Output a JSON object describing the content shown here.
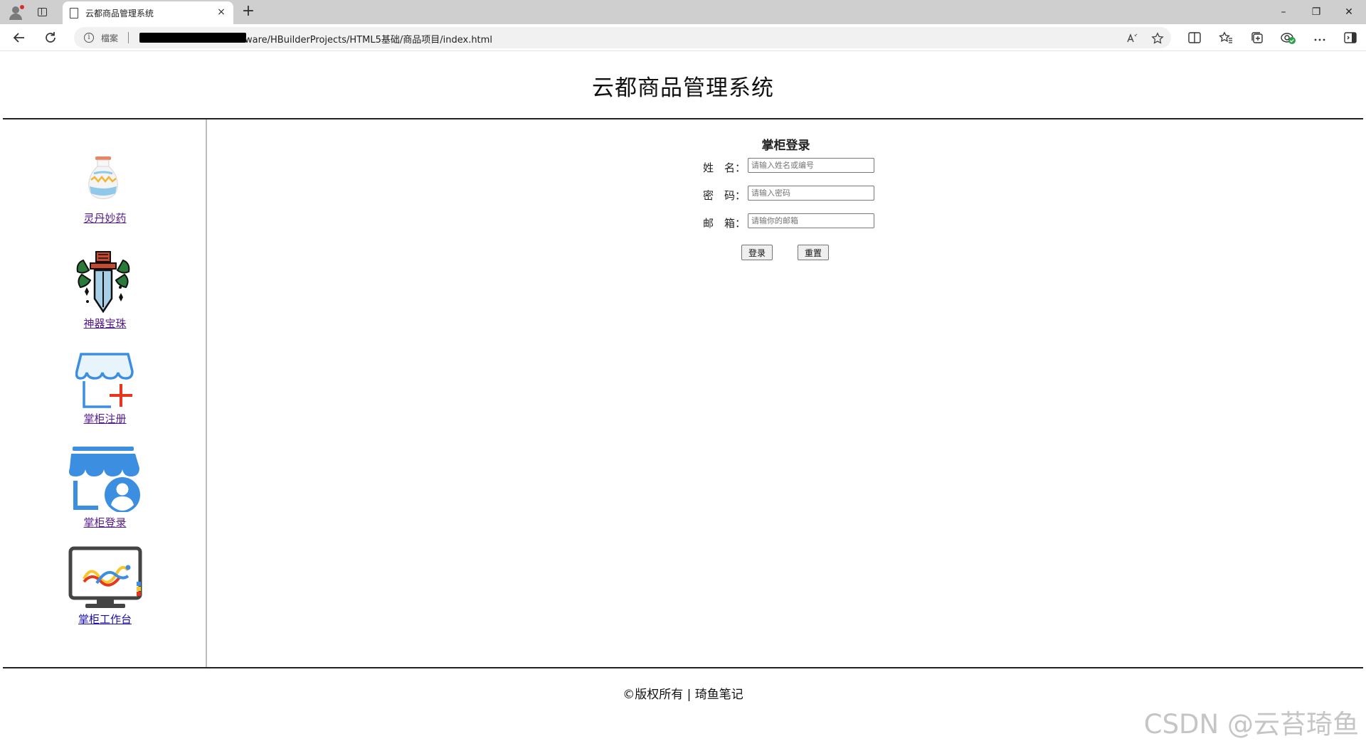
{
  "browser": {
    "tab_title": "云都商品管理系统",
    "tab_close": "×",
    "new_tab": "+",
    "window_controls": {
      "minimize": "–",
      "restore": "❐",
      "close": "✕"
    },
    "address": {
      "site_info_label": "檔案",
      "url_visible": "ware/HBuilderProjects/HTML5基础/商品项目/index.html"
    },
    "icons": [
      "back-icon",
      "refresh-icon",
      "info-icon",
      "read-aloud-icon",
      "favorite-icon",
      "split-screen-icon",
      "favorites-icon",
      "collections-icon",
      "extensions-icon",
      "more-icon",
      "sidebar-icon"
    ]
  },
  "header": {
    "title": "云都商品管理系统"
  },
  "sidebar": {
    "items": [
      {
        "label": "灵丹妙药",
        "icon": "potion-vase-icon"
      },
      {
        "label": "神器宝珠",
        "icon": "sword-icon"
      },
      {
        "label": "掌柜注册",
        "icon": "shop-register-icon"
      },
      {
        "label": "掌柜登录",
        "icon": "shop-login-icon"
      },
      {
        "label": "掌柜工作台",
        "icon": "workbench-monitor-icon"
      }
    ]
  },
  "login_form": {
    "title": "掌柜登录",
    "fields": [
      {
        "label": "姓　名：",
        "value": "",
        "placeholder": "请输入姓名或编号"
      },
      {
        "label": "密　码：",
        "value": "",
        "placeholder": "请输入密码"
      },
      {
        "label": "邮　箱：",
        "value": "",
        "placeholder": "请输你的邮箱"
      }
    ],
    "buttons": {
      "submit": "登录",
      "reset": "重置"
    }
  },
  "footer": {
    "copyright": "©版权所有 | 琦鱼笔记",
    "watermark": "CSDN @云苔琦鱼"
  }
}
